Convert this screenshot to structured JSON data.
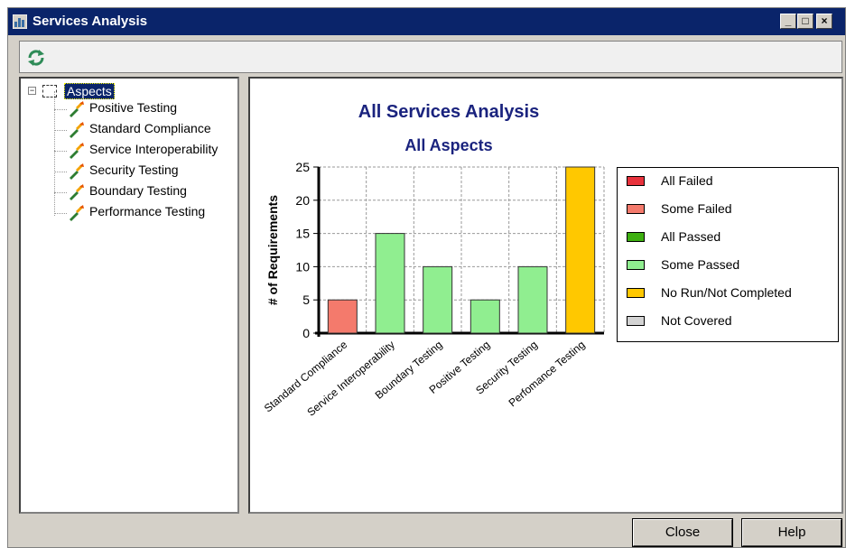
{
  "window": {
    "title": "Services Analysis",
    "minimize": "_",
    "maximize": "□",
    "close": "×"
  },
  "tree": {
    "root": "Aspects",
    "expander": "−",
    "items": [
      {
        "label": "Positive Testing"
      },
      {
        "label": "Standard Compliance"
      },
      {
        "label": "Service Interoperability"
      },
      {
        "label": "Security Testing"
      },
      {
        "label": "Boundary Testing"
      },
      {
        "label": "Performance Testing"
      }
    ]
  },
  "chart_data": {
    "type": "bar",
    "title": "All Services Analysis",
    "subtitle": "All Aspects",
    "ylabel": "# of Requirements",
    "xlabel": "",
    "ylim": [
      0,
      25
    ],
    "yticks": [
      0,
      5,
      10,
      15,
      20,
      25
    ],
    "grid": true,
    "categories": [
      "Standard Compliance",
      "Service Interoperability",
      "Boundary Testing",
      "Positive Testing",
      "Security Testing",
      "Perfomance Testing"
    ],
    "values": [
      5,
      15,
      10,
      5,
      10,
      25
    ],
    "bar_status": [
      "Some Failed",
      "Some Passed",
      "Some Passed",
      "Some Passed",
      "Some Passed",
      "No Run/Not Completed"
    ],
    "legend_position": "right",
    "legend": [
      {
        "label": "All Failed",
        "color": "#e8323c"
      },
      {
        "label": "Some Failed",
        "color": "#f47a6c"
      },
      {
        "label": "All Passed",
        "color": "#3daf10"
      },
      {
        "label": "Some Passed",
        "color": "#90ee90"
      },
      {
        "label": "No Run/Not Completed",
        "color": "#ffc800"
      },
      {
        "label": "Not Covered",
        "color": "#d3d3d3"
      }
    ]
  },
  "footer": {
    "close_label": "Close",
    "help_label": "Help"
  }
}
